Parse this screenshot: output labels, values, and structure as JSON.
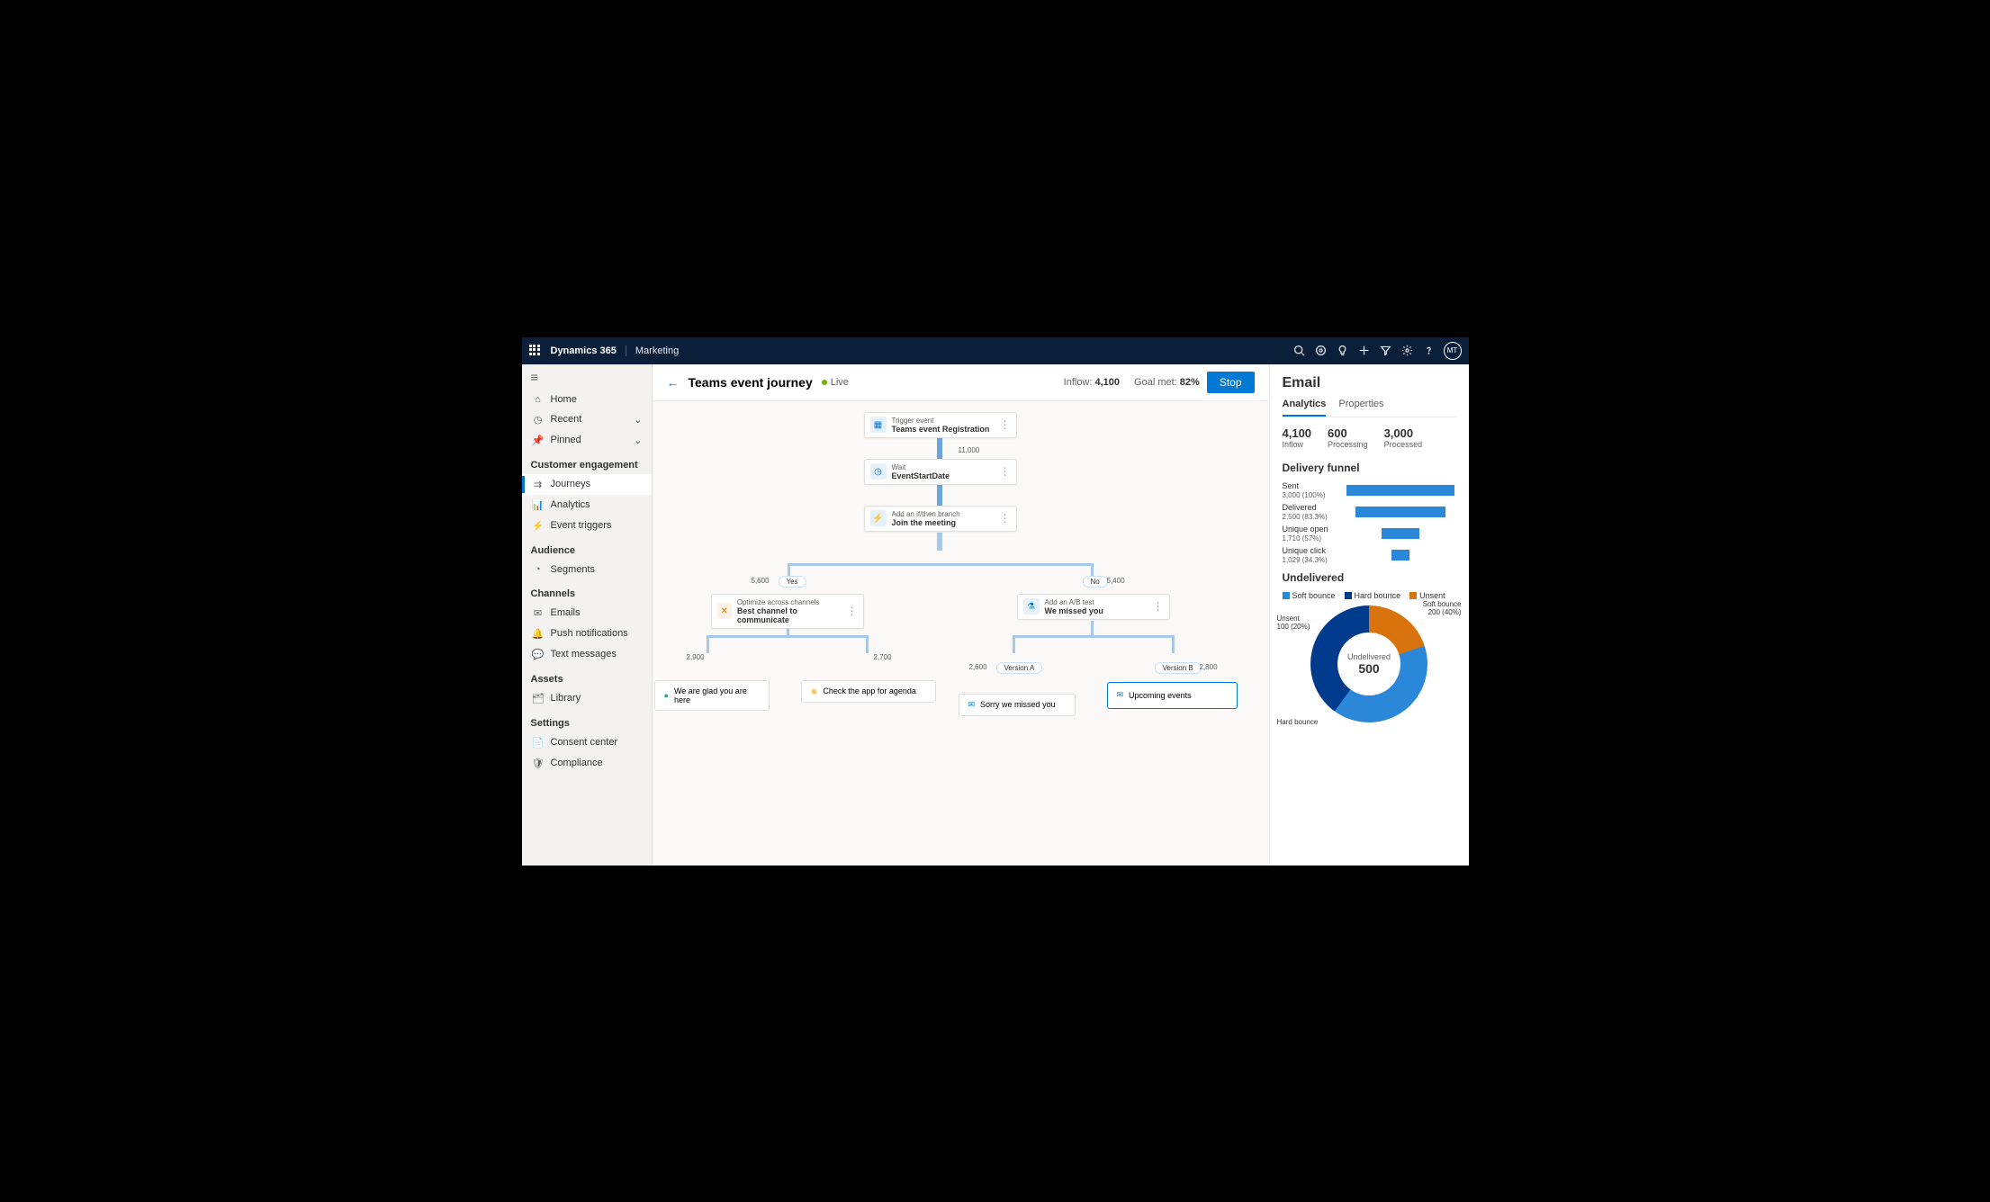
{
  "topnav": {
    "brand": "Dynamics 365",
    "product": "Marketing",
    "avatar": "MT"
  },
  "sidebar": {
    "home": "Home",
    "recent": "Recent",
    "pinned": "Pinned",
    "sections": {
      "customer_engagement": {
        "label": "Customer engagement",
        "items": [
          "Journeys",
          "Analytics",
          "Event triggers"
        ]
      },
      "audience": {
        "label": "Audience",
        "items": [
          "Segments"
        ]
      },
      "channels": {
        "label": "Channels",
        "items": [
          "Emails",
          "Push notifications",
          "Text messages"
        ]
      },
      "assets": {
        "label": "Assets",
        "items": [
          "Library"
        ]
      },
      "settings": {
        "label": "Settings",
        "items": [
          "Consent center",
          "Compliance"
        ]
      }
    }
  },
  "header": {
    "title": "Teams event journey",
    "status": "Live",
    "inflow_label": "Inflow:",
    "inflow_value": "4,100",
    "goal_label": "Goal met:",
    "goal_value": "82%",
    "stop": "Stop"
  },
  "journey": {
    "node1": {
      "type": "Trigger event",
      "title": "Teams event Registration"
    },
    "count1": "11,000",
    "node2": {
      "type": "Wait",
      "title": "EventStartDate"
    },
    "node3": {
      "type": "Add an if/then branch",
      "title": "Join the meeting"
    },
    "yes": "Yes",
    "no": "No",
    "yes_count": "5,600",
    "no_count": "5,400",
    "node_left": {
      "type": "Optimize across channels",
      "title": "Best channel to communicate"
    },
    "node_right": {
      "type": "Add an A/B test",
      "title": "We missed you"
    },
    "left_a_count": "2,900",
    "left_b_count": "2,700",
    "right_a": "Version A",
    "right_a_count": "2,600",
    "right_b": "Version B",
    "right_b_count": "2,800",
    "leaf1": "We are glad you are here",
    "leaf2": "Check the app for agenda",
    "leaf3": "Sorry we missed you",
    "leaf4": "Upcoming events"
  },
  "rpanel": {
    "title": "Email",
    "tabs": {
      "analytics": "Analytics",
      "properties": "Properties"
    },
    "kpis": [
      {
        "value": "4,100",
        "label": "Inflow"
      },
      {
        "value": "600",
        "label": "Processing"
      },
      {
        "value": "3,000",
        "label": "Processed"
      }
    ],
    "funnel_title": "Delivery funnel",
    "funnel": [
      {
        "label": "Sent",
        "detail": "3,000 (100%)",
        "pct": 100
      },
      {
        "label": "Delivered",
        "detail": "2,500 (83.3%)",
        "pct": 83
      },
      {
        "label": "Unique open",
        "detail": "1,710 (57%)",
        "pct": 57
      },
      {
        "label": "Unique click",
        "detail": "1,029 (34.3%)",
        "pct": 34
      }
    ],
    "undelivered_title": "Undelivered",
    "legend": {
      "soft": "Soft bounce",
      "hard": "Hard bounce",
      "unsent": "Unsent"
    },
    "donut": {
      "center_label": "Undelivered",
      "center_value": "500",
      "soft_label": "Soft bounce",
      "soft_detail": "200 (40%)",
      "hard_label": "Hard bounce",
      "unsent_label": "Unsent",
      "unsent_detail": "100 (20%)"
    }
  },
  "chart_data": [
    {
      "type": "bar",
      "title": "Delivery funnel",
      "categories": [
        "Sent",
        "Delivered",
        "Unique open",
        "Unique click"
      ],
      "values": [
        3000,
        2500,
        1710,
        1029
      ],
      "percentages": [
        100,
        83.3,
        57,
        34.3
      ]
    },
    {
      "type": "pie",
      "title": "Undelivered",
      "total": 500,
      "series": [
        {
          "name": "Soft bounce",
          "value": 200,
          "pct": 40,
          "color": "#2b88d8"
        },
        {
          "name": "Hard bounce",
          "value": 200,
          "pct": 40,
          "color": "#003a8c"
        },
        {
          "name": "Unsent",
          "value": 100,
          "pct": 20,
          "color": "#d9730d"
        }
      ]
    }
  ]
}
